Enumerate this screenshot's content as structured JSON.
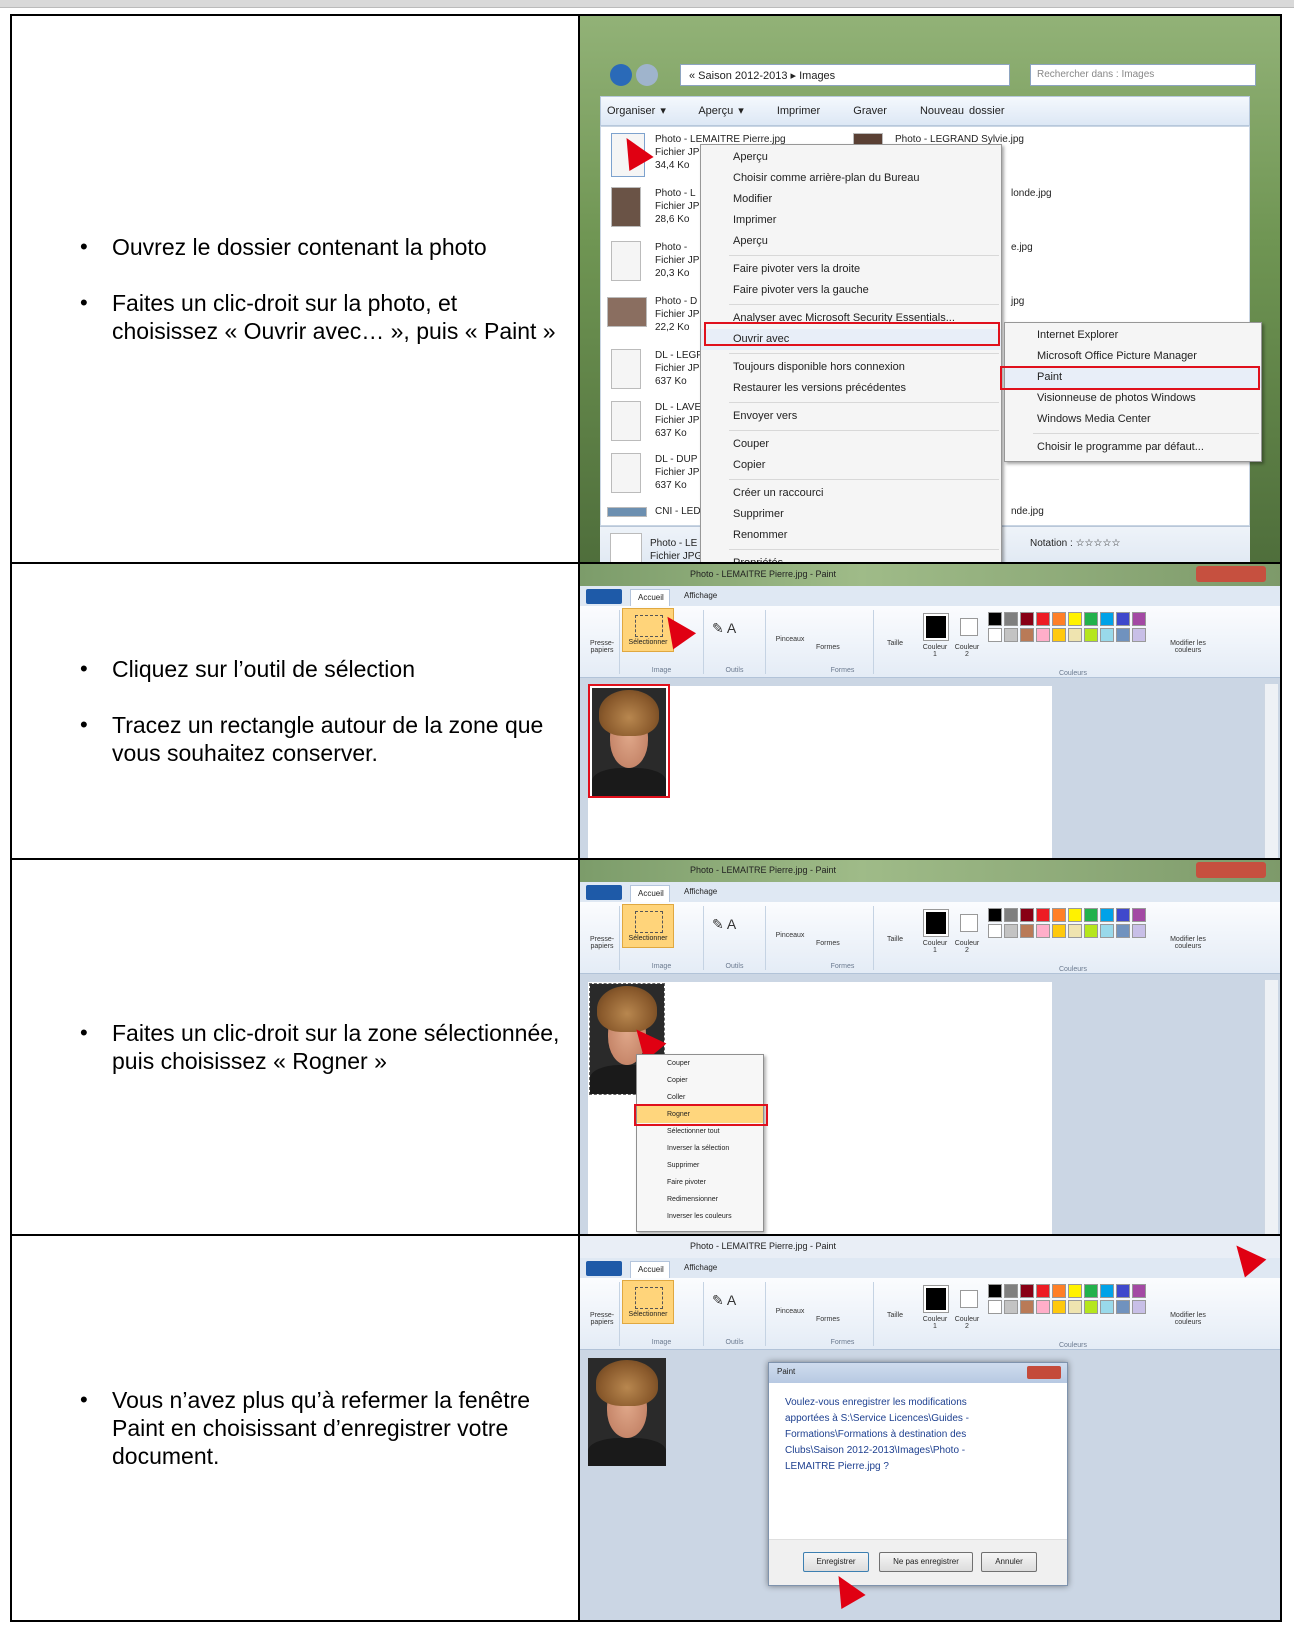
{
  "steps": [
    {
      "bullets": [
        "Ouvrez le dossier contenant la photo",
        "Faites un clic-droit sur la photo, et choisissez « Ouvrir avec… », puis « Paint »"
      ]
    },
    {
      "bullets": [
        "Cliquez sur l’outil de sélection",
        "Tracez un rectangle autour de la zone que vous souhaitez conserver."
      ]
    },
    {
      "bullets": [
        "Faites un clic-droit sur la zone sélectionnée, puis choisissez « Rogner »"
      ]
    },
    {
      "bullets": [
        "Vous n’avez plus qu’à refermer la fenêtre Paint en choisissant d’enregistrer votre document."
      ]
    }
  ],
  "explorer": {
    "breadcrumb": "« Saison 2012-2013 ▸ Images",
    "search_placeholder": "Rechercher dans : Images",
    "toolbar": [
      "Organiser ▾",
      "Aperçu ▾",
      "Imprimer",
      "Graver",
      "Nouveau dossier"
    ],
    "files": [
      {
        "name": "Photo - LEMAITRE Pierre.jpg",
        "type": "Fichier JPG",
        "size": "34,4 Ko"
      },
      {
        "name": "Photo - L",
        "type": "Fichier JP",
        "size": "28,6 Ko"
      },
      {
        "name": "Photo - ",
        "type": "Fichier JP",
        "size": "20,3 Ko"
      },
      {
        "name": "Photo - D",
        "type": "Fichier JP",
        "size": "22,2 Ko"
      },
      {
        "name": "DL - LEGF",
        "type": "Fichier JP",
        "size": "637 Ko"
      },
      {
        "name": "DL - LAVE",
        "type": "Fichier JP",
        "size": "637 Ko"
      },
      {
        "name": "DL - DUP",
        "type": "Fichier JP",
        "size": "637 Ko"
      },
      {
        "name": "CNI - LED",
        "type": "",
        "size": ""
      }
    ],
    "right_files": [
      "Photo - LEGRAND Sylvie.jpg",
      "londe.jpg",
      "e.jpg",
      "jpg",
      "nde.jpg"
    ],
    "details": {
      "name": "Photo - LE",
      "type": "Fichier JPG",
      "rating": "Notation : ☆☆☆☆☆"
    },
    "context_menu": [
      "Aperçu",
      "Choisir comme arrière-plan du Bureau",
      "Modifier",
      "Imprimer",
      "Aperçu",
      "Faire pivoter vers la droite",
      "Faire pivoter vers la gauche",
      "Analyser avec Microsoft Security Essentials...",
      "Ouvrir avec",
      "Toujours disponible hors connexion",
      "Restaurer les versions précédentes",
      "Envoyer vers",
      "Couper",
      "Copier",
      "Créer un raccourci",
      "Supprimer",
      "Renommer",
      "Propriétés"
    ],
    "open_with": [
      "Internet Explorer",
      "Microsoft Office Picture Manager",
      "Paint",
      "Visionneuse de photos Windows",
      "Windows Media Center",
      "Choisir le programme par défaut..."
    ]
  },
  "paint": {
    "title": "Photo - LEMAITRE Pierre.jpg - Paint",
    "tabs": [
      "Accueil",
      "Affichage"
    ],
    "groups": [
      "Image",
      "Outils",
      "Formes",
      "Couleurs"
    ],
    "tools": {
      "clipboard": "Presse-papiers",
      "select": "Sélectionner",
      "brushes": "Pinceaux",
      "shapes": "Formes",
      "size": "Taille",
      "color1": "Couleur 1",
      "color2": "Couleur 2",
      "edit_colors": "Modifier les couleurs"
    },
    "palette": [
      "#000000",
      "#7f7f7f",
      "#880015",
      "#ed1c24",
      "#ff7f27",
      "#fff200",
      "#22b14c",
      "#00a2e8",
      "#3f48cc",
      "#a349a4",
      "#ffffff",
      "#c3c3c3",
      "#b97a57",
      "#ffaec9",
      "#ffc90e",
      "#efe4b0",
      "#b5e61d",
      "#99d9ea",
      "#7092be",
      "#c8bfe7"
    ],
    "crop_menu": [
      "Couper",
      "Copier",
      "Coller",
      "Rogner",
      "Sélectionner tout",
      "Inverser la sélection",
      "Supprimer",
      "Faire pivoter",
      "Redimensionner",
      "Inverser les couleurs"
    ]
  },
  "dialog": {
    "title": "Paint",
    "message": "Voulez-vous enregistrer les modifications apportées à S:\\Service Licences\\Guides - Formations\\Formations à destination des Clubs\\Saison 2012-2013\\Images\\Photo - LEMAITRE Pierre.jpg ?",
    "buttons": [
      "Enregistrer",
      "Ne pas enregistrer",
      "Annuler"
    ]
  }
}
